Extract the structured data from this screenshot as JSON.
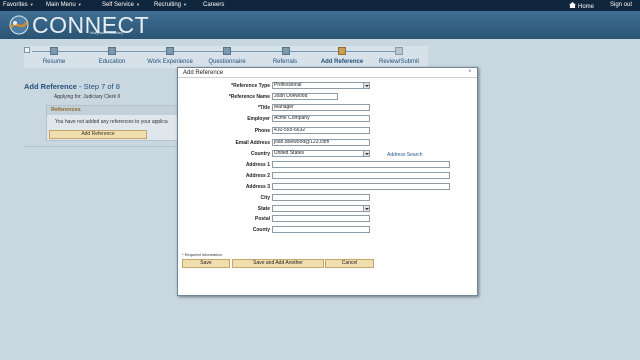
{
  "topnav": {
    "items": [
      "Favorites",
      "Main Menu",
      "Self Service",
      "Recruiting",
      "Careers"
    ],
    "home": "Home",
    "signout": "Sign out"
  },
  "banner": {
    "brand": "CONNECT",
    "subtitle": "Maryland Judiciary"
  },
  "steps": [
    {
      "label": "Resume"
    },
    {
      "label": "Education"
    },
    {
      "label": "Work Experience"
    },
    {
      "label": "Questionnaire"
    },
    {
      "label": "Referrals"
    },
    {
      "label": "Add Reference",
      "active": true
    },
    {
      "label": "Review/Submit"
    }
  ],
  "page": {
    "title": "Add Reference",
    "step_text": "- Step 7 of 8",
    "applying": "Applying for: Judiciary Clerk II",
    "references_head": "References",
    "references_msg": "You have not added any references to your applica",
    "add_reference_button": "Add Reference"
  },
  "modal": {
    "title": "Add Reference",
    "fields": {
      "reference_type": {
        "label": "*Reference Type",
        "value": "Professional"
      },
      "reference_name": {
        "label": "*Reference Name",
        "value": "Joan Doewood"
      },
      "title": {
        "label": "*Title",
        "value": "Manager"
      },
      "employer": {
        "label": "Employer",
        "value": "Acme Company"
      },
      "phone": {
        "label": "Phone",
        "value": "410-555-6632"
      },
      "email": {
        "label": "Email Address",
        "value": "joan.doewood@123.com"
      },
      "country": {
        "label": "Country",
        "value": "United States"
      },
      "address1": {
        "label": "Address 1",
        "value": ""
      },
      "address2": {
        "label": "Address 2",
        "value": ""
      },
      "address3": {
        "label": "Address 3",
        "value": ""
      },
      "city": {
        "label": "City",
        "value": ""
      },
      "state": {
        "label": "State",
        "value": ""
      },
      "postal": {
        "label": "Postal",
        "value": ""
      },
      "county": {
        "label": "County",
        "value": ""
      }
    },
    "address_search": "Address Search",
    "required_info": "* Required information",
    "buttons": {
      "save": "Save",
      "save_add": "Save and Add Another",
      "cancel": "Cancel"
    }
  },
  "colors": {
    "nav": "#10263c",
    "banner": "#2f5a7a",
    "accent_button": "#f1deae",
    "link": "#2b5a8f"
  },
  "icons": [
    "home-icon",
    "close-icon",
    "logo-seal-icon",
    "dropdown-arrow-icon"
  ]
}
